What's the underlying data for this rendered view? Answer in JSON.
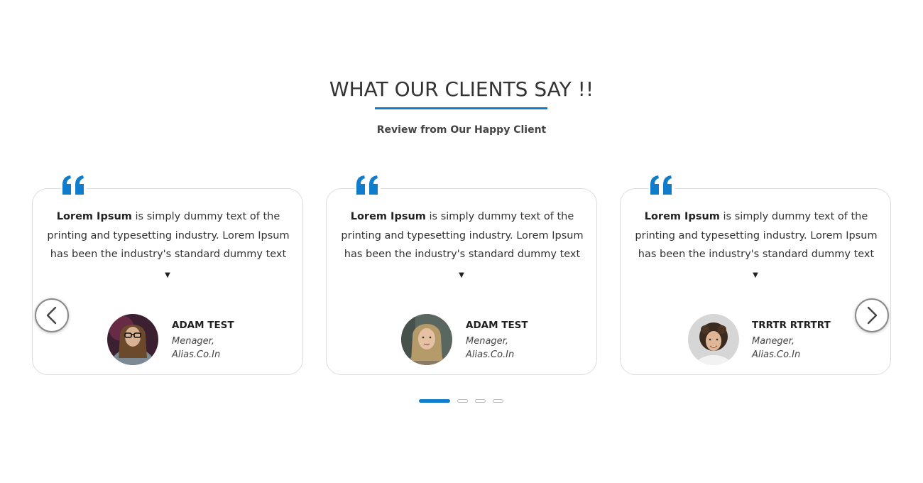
{
  "section": {
    "title": "WHAT OUR CLIENTS SAY !!",
    "subtitle": "Review from Our Happy Client"
  },
  "cards": [
    {
      "text_bold": "Lorem Ipsum",
      "text_rest": " is simply dummy text of the printing and typesetting industry. Lorem Ipsum has been the industry's standard dummy text",
      "expand_glyph": "▼",
      "name": "ADAM TEST",
      "role_line1": "Menager,",
      "role_line2": "Alias.Co.In"
    },
    {
      "text_bold": "Lorem Ipsum",
      "text_rest": " is simply dummy text of the printing and typesetting industry. Lorem Ipsum has been the industry's standard dummy text",
      "expand_glyph": "▼",
      "name": "ADAM TEST",
      "role_line1": "Menager,",
      "role_line2": "Alias.Co.In"
    },
    {
      "text_bold": "Lorem Ipsum",
      "text_rest": " is simply dummy text of the printing and typesetting industry. Lorem Ipsum has been the industry's standard dummy text",
      "expand_glyph": "▼",
      "name": "TRRTR RTRTRT",
      "role_line1": "Maneger,",
      "role_line2": "Alias.Co.In"
    }
  ],
  "icons": {
    "quote": "quote-icon",
    "prev": "chevron-left-icon",
    "next": "chevron-right-icon"
  },
  "colors": {
    "accent": "#0f7ccc",
    "heading": "#333333",
    "card_border": "#dddddd"
  },
  "pagination": {
    "count": 4,
    "active_index": 0
  }
}
